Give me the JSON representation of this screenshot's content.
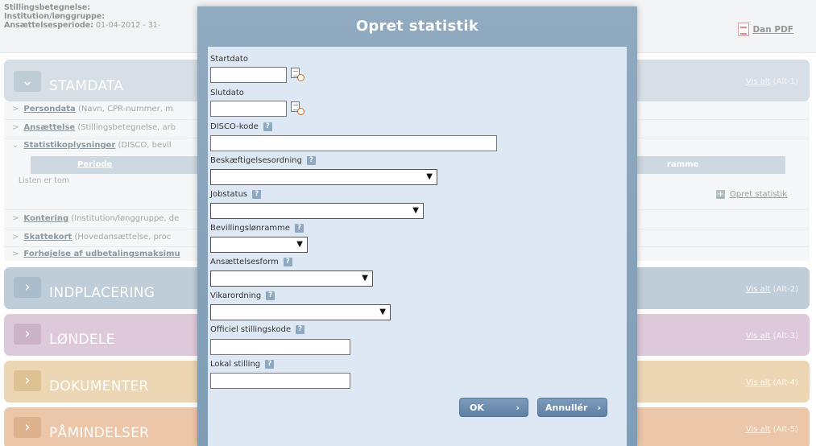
{
  "page": {
    "info": {
      "line1_label": "Stillingsbetegnelse:",
      "line2_label": "Institution/lønggruppe:",
      "line3_label": "Ansættelsesperiode:",
      "line3_value": "01-04-2012 - 31-",
      "pdf_label": "Dan PDF"
    },
    "stamdata": {
      "title": "STAMDATA",
      "vis_alt": "Vis alt",
      "shortcut": "(Alt-1)"
    },
    "rows": [
      {
        "label": "Persondata",
        "desc": "(Navn, CPR-nummer, m"
      },
      {
        "label": "Ansættelse",
        "desc": "(Stillingsbetegnelse, arb"
      },
      {
        "label": "Statistikoplysninger",
        "desc": "(DISCO, bevil"
      }
    ],
    "table": {
      "col_periode": "Periode",
      "col_ramme": "ramme",
      "empty_text": "Listen er tom",
      "opret_label": "Opret statistik"
    },
    "rows2": [
      {
        "label": "Kontering",
        "desc": "(Institution/lønggruppe, de"
      },
      {
        "label": "Skattekort",
        "desc": "(Hovedansættelse, proc"
      },
      {
        "label": "Forhøjelse af udbetalingsmaksimu",
        "desc": ""
      }
    ],
    "bands": [
      {
        "title": "INDPLACERING",
        "vis_alt": "Vis alt",
        "shortcut": "(Alt-2)",
        "color": "#8fa9bc",
        "btn": "#6e8ea7"
      },
      {
        "title": "LØNDELE",
        "vis_alt": "Vis alt",
        "shortcut": "(Alt-3)",
        "color": "#c7a2bf",
        "btn": "#a77a9c"
      },
      {
        "title": "DOKUMENTER",
        "vis_alt": "Vis alt",
        "shortcut": "(Alt-4)",
        "color": "#e0b97c",
        "btn": "#c99646"
      },
      {
        "title": "PÅMINDELSER",
        "vis_alt": "Vis alt",
        "shortcut": "(Alt-5)",
        "color": "#de9d6a",
        "btn": "#c97b3d"
      }
    ]
  },
  "modal": {
    "title": "Opret statistik",
    "fields": {
      "startdato": {
        "label": "Startdato",
        "value": ""
      },
      "slutdato": {
        "label": "Slutdato",
        "value": ""
      },
      "disco": {
        "label": "DISCO-kode",
        "value": ""
      },
      "beskaeftigelse": {
        "label": "Beskæftigelsesordning",
        "value": ""
      },
      "jobstatus": {
        "label": "Jobstatus",
        "value": ""
      },
      "bevilling": {
        "label": "Bevillingslønramme",
        "value": ""
      },
      "ansaettelsesform": {
        "label": "Ansættelsesform",
        "value": ""
      },
      "vikarordning": {
        "label": "Vikarordning",
        "value": ""
      },
      "officiel": {
        "label": "Officiel stillingskode",
        "value": ""
      },
      "lokal": {
        "label": "Lokal stilling",
        "value": ""
      }
    },
    "help_glyph": "?",
    "ok_label": "OK",
    "cancel_label": "Annullér",
    "arrow_glyph": "›"
  },
  "icons": {
    "band_expand": "chevron-right-icon",
    "stamdata_expand": "chevron-down-icon",
    "calendar": "calendar-clock-icon",
    "pdf": "pdf-icon",
    "help": "help-icon",
    "plus": "plus-icon"
  }
}
